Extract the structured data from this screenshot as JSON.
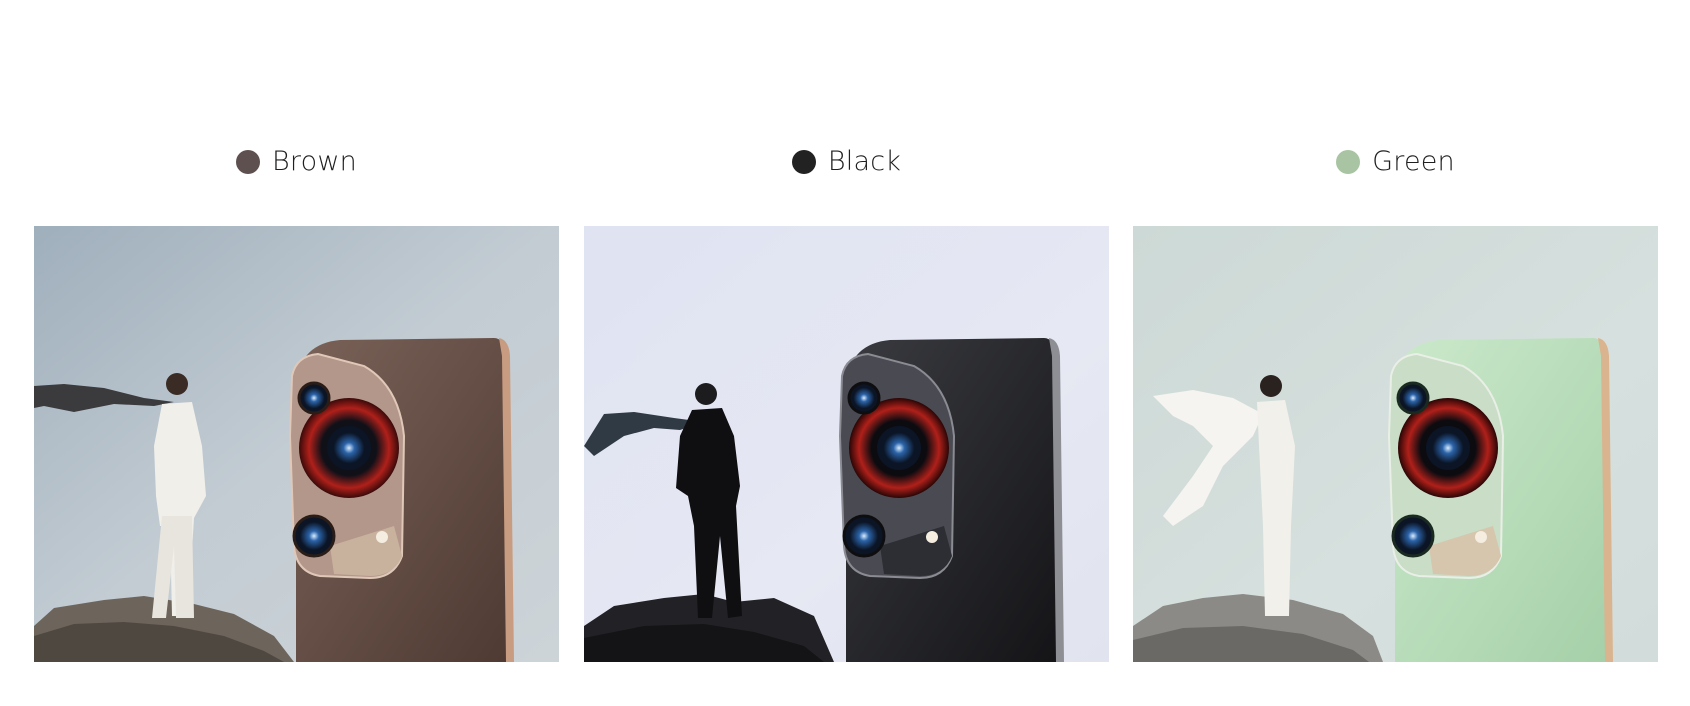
{
  "colors": [
    {
      "name": "Brown",
      "swatch": "#5f5050"
    },
    {
      "name": "Black",
      "swatch": "#222222"
    },
    {
      "name": "Green",
      "swatch": "#a9c4a2"
    }
  ]
}
